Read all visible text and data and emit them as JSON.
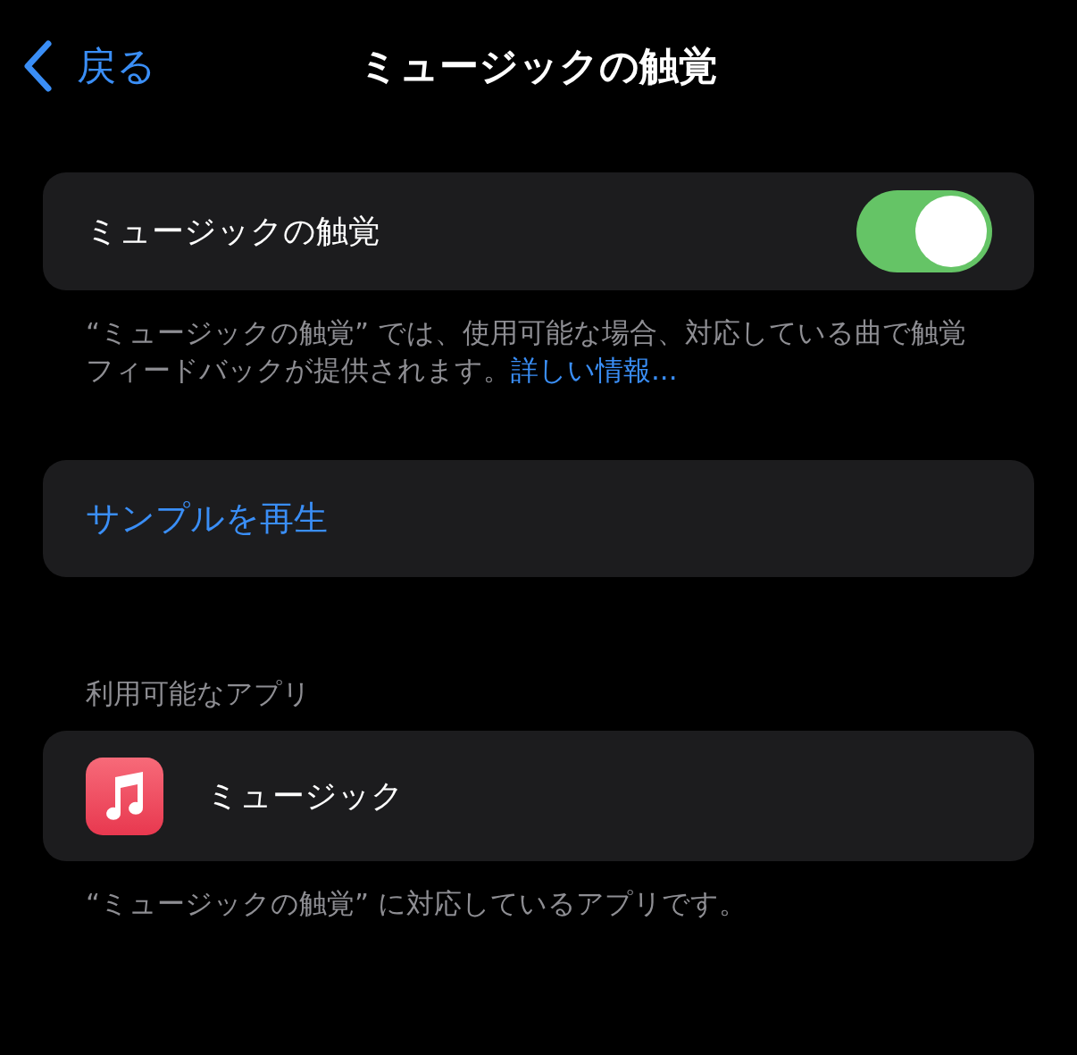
{
  "nav": {
    "back": "戻る",
    "title": "ミュージックの触覚"
  },
  "toggle_row": {
    "label": "ミュージックの触覚",
    "on": true
  },
  "toggle_footer": {
    "text": "“ミュージックの触覚” では、使用可能な場合、対応している曲で触覚フィードバックが提供されます。",
    "link": "詳しい情報..."
  },
  "sample_button": "サンプルを再生",
  "apps_header": "利用可能なアプリ",
  "apps": [
    {
      "name": "ミュージック"
    }
  ],
  "apps_footer": "“ミュージックの触覚” に対応しているアプリです。"
}
